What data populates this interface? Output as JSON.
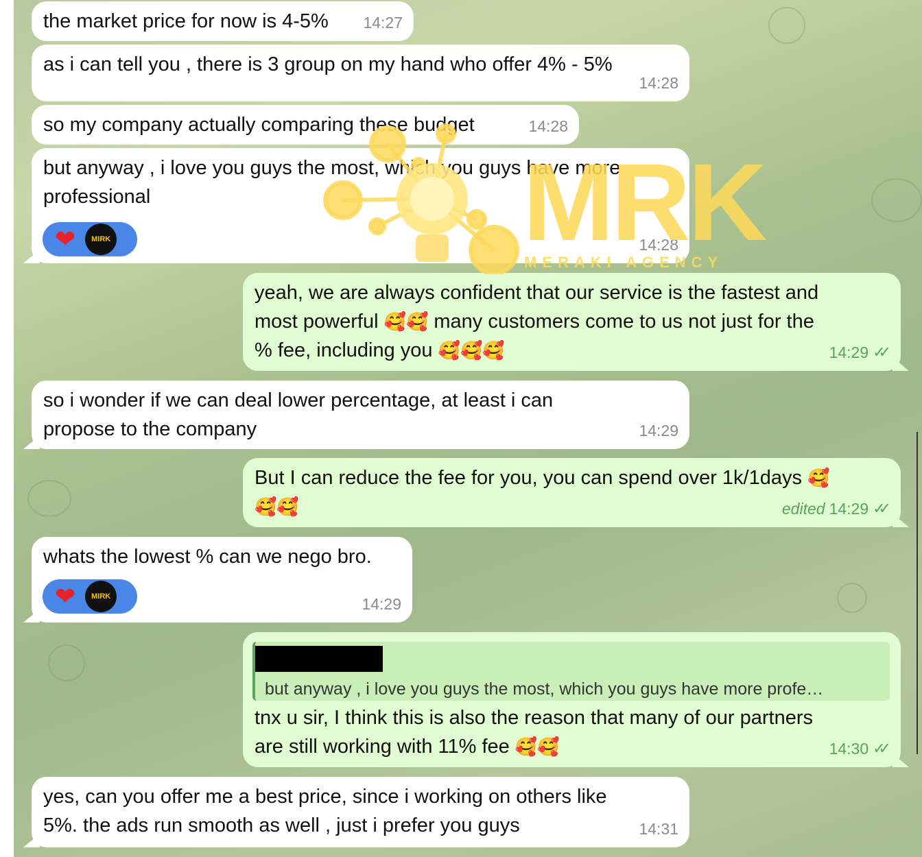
{
  "messages": [
    {
      "text": "the market price for now is 4-5%",
      "time": "14:27"
    },
    {
      "text": "as i can tell you , there is 3 group on my hand who offer 4% - 5%",
      "time": "14:28"
    },
    {
      "text": "so my company actually comparing these budget",
      "time": "14:28"
    },
    {
      "text_line1": "but anyway , i love you guys the most, which you guys have more",
      "text_line2": "professional",
      "time": "14:28"
    },
    {
      "line1": "yeah, we are always confident that our service is the fastest and",
      "line2a": "most powerful",
      "line2b": "many customers come to us not just for the",
      "line3": "% fee, including you",
      "time": "14:29"
    },
    {
      "line1": "so i wonder if we can deal lower percentage, at least i can",
      "line2": "propose to the company",
      "time": "14:29"
    },
    {
      "line1": "But I can reduce the fee for you, you can spend over 1k/1days",
      "edited_label": "edited",
      "time": "14:29"
    },
    {
      "text": "whats the lowest % can we nego bro.",
      "time": "14:29"
    },
    {
      "reply_quote": "but anyway , i love you guys the most, which you guys have more profe…",
      "line1": "tnx u sir, I think this is also the reason that many of our partners",
      "line2": "are still working with 11% fee",
      "time": "14:30"
    },
    {
      "line1": "yes, can you offer me a best price, since i working on others like",
      "line2": "5%. the ads run smooth as well , just i prefer you guys",
      "time": "14:31"
    }
  ],
  "emoji": {
    "smiling_hearts": "🥰",
    "heart": "❤"
  },
  "reaction_avatar_label": "MIRK",
  "watermark": {
    "logo": "MRK",
    "subtitle": "MERAKI AGENCY"
  }
}
